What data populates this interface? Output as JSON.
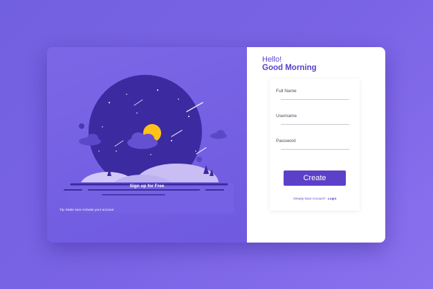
{
  "left_panel": {
    "signup_text": "Sign up for Free",
    "tip_text": "Tip:  Make sure Activate your account"
  },
  "right_panel": {
    "greeting_line1": "Hello!",
    "greeting_line2": "Good Morning",
    "fields": [
      {
        "label": "Full Name",
        "value": ""
      },
      {
        "label": "Username",
        "value": ""
      },
      {
        "label": "Password",
        "value": ""
      }
    ],
    "create_label": "Create",
    "already_text": "Already have Account?",
    "login_label": "Login"
  },
  "colors": {
    "background": "#7b64e6",
    "panel_left": "#7561e3",
    "accent": "#5c40c8",
    "night_sky": "#3a2a9e",
    "moon": "#ffc21a",
    "hills": "#cfc3f7"
  },
  "icons": [
    "moon-icon",
    "shooting-star-icon",
    "cloud-icon",
    "tree-icon"
  ]
}
